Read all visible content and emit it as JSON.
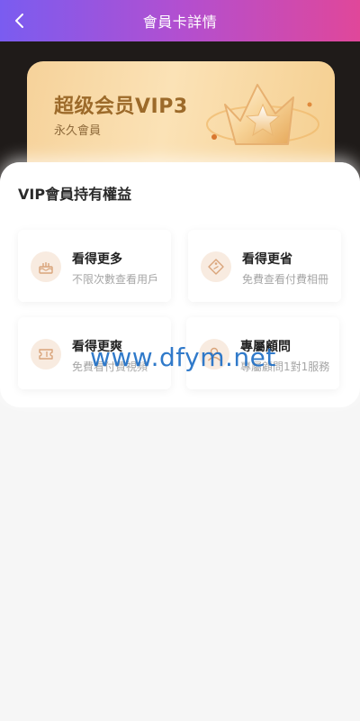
{
  "header": {
    "title": "會員卡詳情",
    "back_icon": "chevron-left-icon"
  },
  "vip_card": {
    "title": "超级会员VIP3",
    "subtitle": "永久會員",
    "emblem_icon": "star-crown-icon"
  },
  "benefits_panel": {
    "title": "VIP會員持有權益",
    "items": [
      {
        "title": "看得更多",
        "desc": "不限次數查看用戶",
        "icon": "cake-icon"
      },
      {
        "title": "看得更省",
        "desc": "免費查看付費相冊",
        "icon": "tag-icon"
      },
      {
        "title": "看得更爽",
        "desc": "免費看付費視頻",
        "icon": "ticket-icon"
      },
      {
        "title": "專屬顧問",
        "desc": "專屬顧問1對1服務",
        "icon": "user-icon"
      }
    ]
  },
  "watermark": "www.dfym.net",
  "colors": {
    "header_gradient_start": "#7a5cf0",
    "header_gradient_end": "#e0479a",
    "vip_gold": "#9c6a2a",
    "card_gold": "#f6d29a"
  }
}
